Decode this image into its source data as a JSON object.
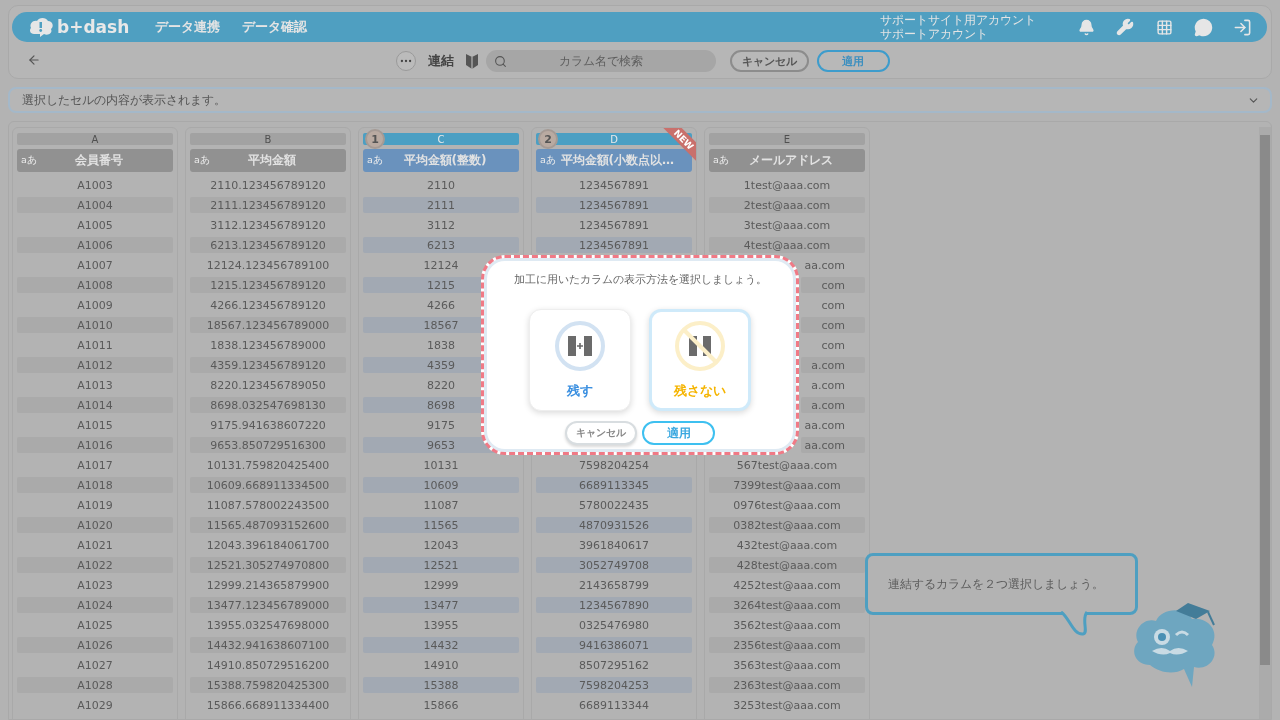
{
  "header": {
    "logo": "b+dash",
    "nav": [
      {
        "label": "データ連携"
      },
      {
        "label": "データ確認"
      }
    ],
    "account": [
      "サポートサイト用アカウント",
      "サポートアカウント"
    ]
  },
  "toolbar": {
    "title": "連結",
    "search": {
      "placeholder": "カラム名で検索"
    },
    "buttons": [
      {
        "label": "キャンセル",
        "kind": "secondary"
      },
      {
        "label": "適用",
        "kind": "primary"
      }
    ]
  },
  "cell_preview": {
    "text": "選択したセルの内容が表示されます。"
  },
  "columns": [
    {
      "letter": "A",
      "type_label": "aあ",
      "name": "会員番号",
      "selected": false,
      "cells": [
        "A1003",
        "A1004",
        "A1005",
        "A1006",
        "A1007",
        "A1008",
        "A1009",
        "A1010",
        "A1011",
        "A1012",
        "A1013",
        "A1014",
        "A1015",
        "A1016",
        "A1017",
        "A1018",
        "A1019",
        "A1020",
        "A1021",
        "A1022",
        "A1023",
        "A1024",
        "A1025",
        "A1026",
        "A1027",
        "A1028",
        "A1029"
      ]
    },
    {
      "letter": "B",
      "type_label": "aあ",
      "name": "平均金額",
      "selected": false,
      "cells": [
        "2110.123456789120",
        "2111.123456789120",
        "3112.123456789120",
        "6213.123456789120",
        "12124.123456789100",
        "1215.123456789120",
        "4266.123456789120",
        "18567.123456789000",
        "1838.123456789000",
        "4359.123456789120",
        "8220.123456789050",
        "8698.032547698130",
        "9175.941638607220",
        "9653.850729516300",
        "10131.759820425400",
        "10609.668911334500",
        "11087.578002243500",
        "11565.487093152600",
        "12043.396184061700",
        "12521.305274970800",
        "12999.214365879900",
        "13477.123456789000",
        "13955.032547698000",
        "14432.941638607100",
        "14910.850729516200",
        "15388.759820425300",
        "15866.668911334400"
      ]
    },
    {
      "letter": "C",
      "type_label": "aあ",
      "name": "平均金額(整数)",
      "selected": true,
      "order": "1",
      "cells": [
        "2110",
        "2111",
        "3112",
        "6213",
        "12124",
        "1215",
        "4266",
        "18567",
        "1838",
        "4359",
        "8220",
        "8698",
        "9175",
        "9653",
        "10131",
        "10609",
        "11087",
        "11565",
        "12043",
        "12521",
        "12999",
        "13477",
        "13955",
        "14432",
        "14910",
        "15388",
        "15866"
      ]
    },
    {
      "letter": "D",
      "type_label": "aあ",
      "name": "平均金額(小数点以…",
      "selected": true,
      "order": "2",
      "ribbon": "NEW",
      "cells": [
        "1234567891",
        "1234567891",
        "1234567891",
        "1234567891",
        null,
        null,
        null,
        null,
        null,
        null,
        null,
        null,
        null,
        null,
        "7598204254",
        "6689113345",
        "5780022435",
        "4870931526",
        "3961840617",
        "3052749708",
        "2143658799",
        "1234567890",
        "0325476980",
        "9416386071",
        "8507295162",
        "7598204253",
        "6689113344"
      ]
    },
    {
      "letter": "E",
      "type_label": "aあ",
      "name": "メールアドレス",
      "selected": false,
      "cells": [
        "1test@aaa.com",
        "2test@aaa.com",
        "3test@aaa.com",
        "4test@aaa.com",
        {
          "text": "aa.com",
          "cut": true
        },
        {
          "text": "com",
          "cut": true
        },
        {
          "text": "com",
          "cut": true
        },
        {
          "text": "com",
          "cut": true
        },
        {
          "text": "com",
          "cut": true
        },
        {
          "text": "a.com",
          "cut": true
        },
        {
          "text": "a.com",
          "cut": true
        },
        {
          "text": "a.com",
          "cut": true
        },
        {
          "text": "aa.com",
          "cut": true
        },
        {
          "text": "aa.com",
          "cut": true
        },
        "567test@aaa.com",
        "7399test@aaa.com",
        "0976test@aaa.com",
        "0382test@aaa.com",
        "432test@aaa.com",
        "428test@aaa.com",
        "4252test@aaa.com",
        "3264test@aaa.com",
        "3562test@aaa.com",
        "2356test@aaa.com",
        "3563test@aaa.com",
        "2363test@aaa.com",
        "3253test@aaa.com"
      ]
    }
  ],
  "dialog": {
    "prompt": "加工に用いたカラムの表示方法を選択しましょう。",
    "options": [
      {
        "label": "残す",
        "kind": "keep",
        "selected": false
      },
      {
        "label": "残さない",
        "kind": "remove",
        "selected": true
      }
    ],
    "buttons": [
      {
        "label": "キャンセル",
        "kind": "secondary"
      },
      {
        "label": "適用",
        "kind": "primary"
      }
    ]
  },
  "assistant": {
    "message": "連結するカラムを２つ選択しましょう。"
  }
}
